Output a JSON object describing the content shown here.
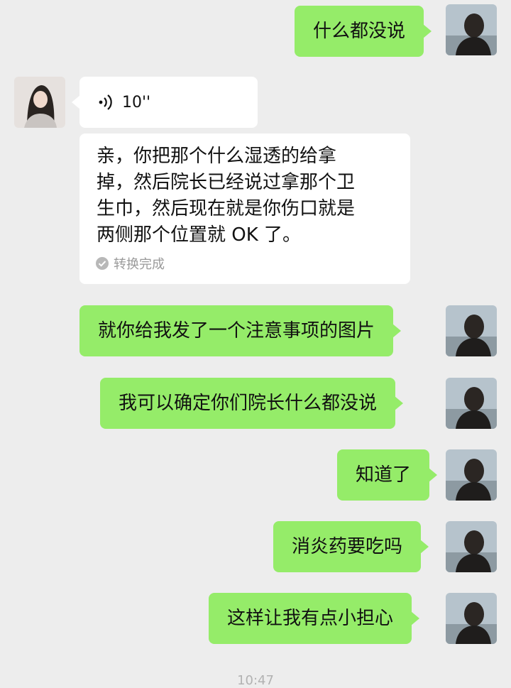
{
  "chat": {
    "messages": [
      {
        "sender": "me",
        "text": "什么都没说"
      },
      {
        "sender": "other",
        "type": "voice",
        "duration": "10''",
        "transcript_lines": [
          "亲，你把那个什么湿透的给拿",
          "掉，然后院长已经说过拿那个卫",
          "生巾，然后现在就是你伤口就是",
          "两侧那个位置就 OK 了。"
        ],
        "transcript_status": "转换完成"
      },
      {
        "sender": "me",
        "text": "就你给我发了一个注意事项的图片"
      },
      {
        "sender": "me",
        "text": "我可以确定你们院长什么都没说"
      },
      {
        "sender": "me",
        "text": "知道了"
      },
      {
        "sender": "me",
        "text": "消炎药要吃吗"
      },
      {
        "sender": "me",
        "text": "这样让我有点小担心"
      }
    ],
    "timestamp": "10:47"
  },
  "colors": {
    "background": "#ededed",
    "sent_bubble": "#95ec69",
    "received_bubble": "#ffffff"
  },
  "icons": {
    "voice": "voice-wave-icon",
    "status": "check-circle-icon"
  }
}
